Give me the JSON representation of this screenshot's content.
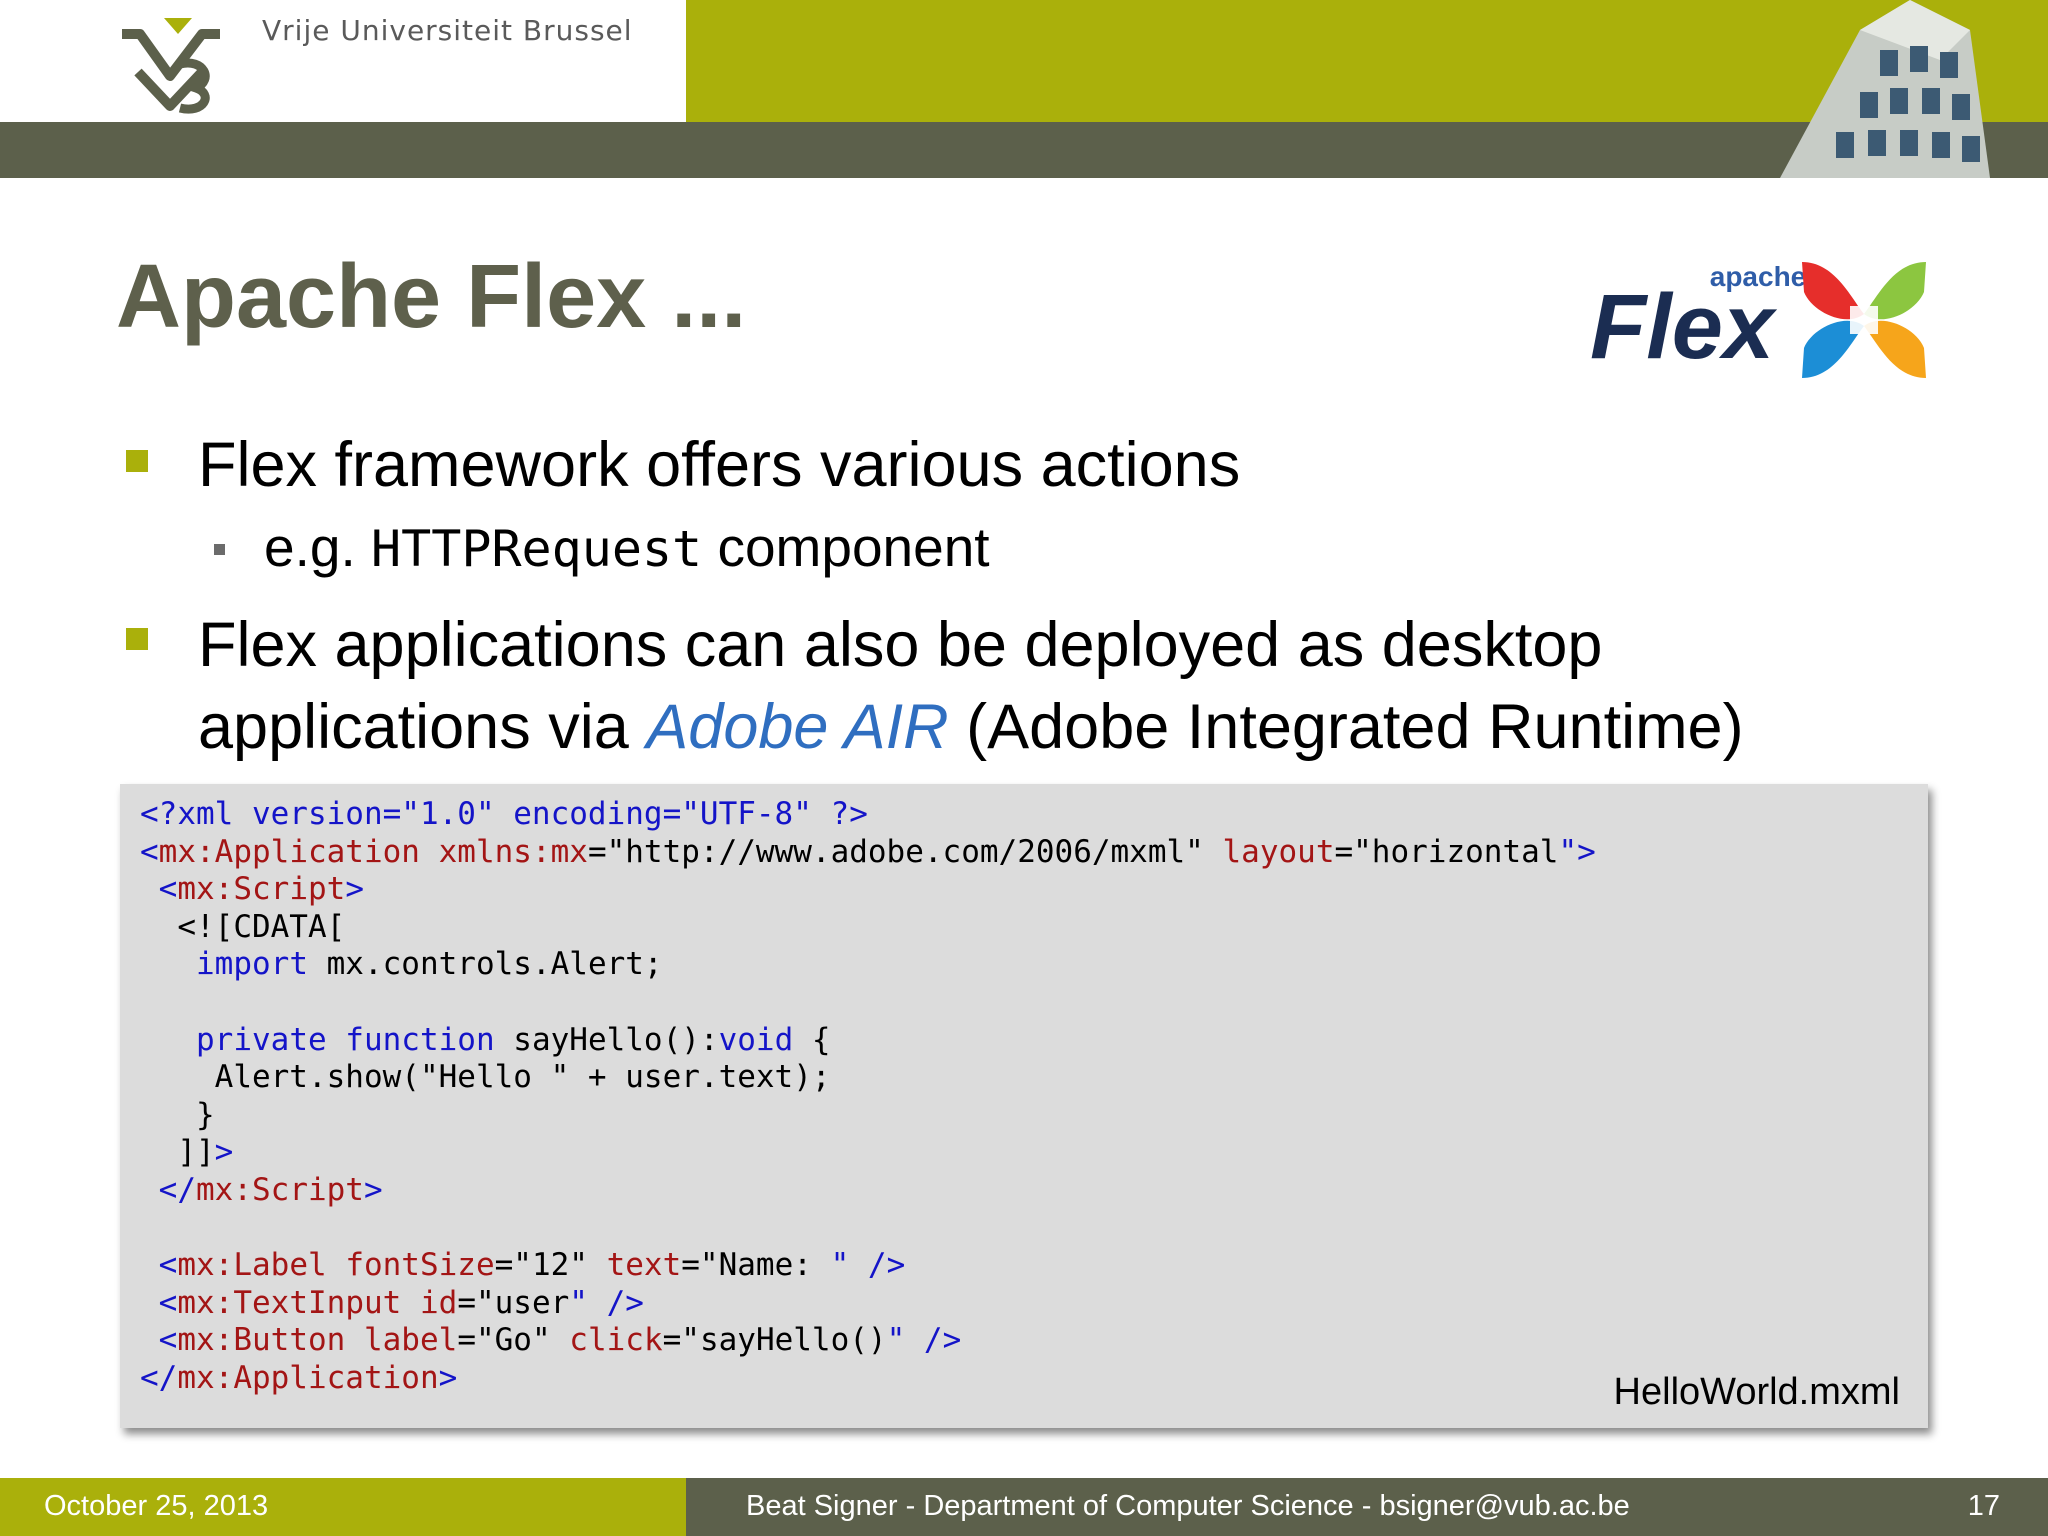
{
  "header": {
    "university": "Vrije Universiteit Brussel",
    "colors": {
      "olive": "#aab00b",
      "dark": "#5c604b"
    }
  },
  "slide": {
    "title": "Apache Flex ...",
    "logo": {
      "small_text": "apache",
      "big_text": "Flex"
    },
    "bullets": [
      {
        "text": "Flex framework offers various actions",
        "sub": {
          "prefix": "e.g. ",
          "code": "HTTPRequest",
          "suffix": " component"
        }
      },
      {
        "line1": "Flex applications can also be deployed as desktop",
        "line2_prefix": "applications via ",
        "line2_link": "Adobe AIR",
        "line2_suffix": " (Adobe Integrated Runtime)"
      }
    ],
    "code": {
      "filename": "HelloWorld.mxml",
      "lines": [
        [
          [
            "b",
            "<?xml version=\"1.0\" encoding=\"UTF-8\" ?>"
          ]
        ],
        [
          [
            "b",
            "<"
          ],
          [
            "r",
            "mx:Application xmlns:mx"
          ],
          [
            "k",
            "=\"http://www.adobe.com/2006/mxml\" "
          ],
          [
            "r",
            "layout"
          ],
          [
            "k",
            "=\"horizontal"
          ],
          [
            "b",
            "\">"
          ]
        ],
        [
          [
            "k",
            " "
          ],
          [
            "b",
            "<"
          ],
          [
            "r",
            "mx:Script"
          ],
          [
            "b",
            ">"
          ]
        ],
        [
          [
            "k",
            "  <![CDATA["
          ]
        ],
        [
          [
            "k",
            "   "
          ],
          [
            "b",
            "import"
          ],
          [
            "k",
            " mx.controls.Alert;"
          ]
        ],
        [
          [
            "k",
            ""
          ]
        ],
        [
          [
            "k",
            "   "
          ],
          [
            "b",
            "private function"
          ],
          [
            "k",
            " sayHello():"
          ],
          [
            "b",
            "void"
          ],
          [
            "k",
            " {"
          ]
        ],
        [
          [
            "k",
            "    Alert.show(\"Hello \" + user.text);"
          ]
        ],
        [
          [
            "k",
            "   }"
          ]
        ],
        [
          [
            "k",
            "  ]]"
          ],
          [
            "b",
            ">"
          ]
        ],
        [
          [
            "k",
            " "
          ],
          [
            "b",
            "</"
          ],
          [
            "r",
            "mx:Script"
          ],
          [
            "b",
            ">"
          ]
        ],
        [
          [
            "k",
            ""
          ]
        ],
        [
          [
            "k",
            " "
          ],
          [
            "b",
            "<"
          ],
          [
            "r",
            "mx:Label fontSize"
          ],
          [
            "k",
            "=\"12\" "
          ],
          [
            "r",
            "text"
          ],
          [
            "k",
            "=\"Name: "
          ],
          [
            "b",
            "\" />"
          ]
        ],
        [
          [
            "k",
            " "
          ],
          [
            "b",
            "<"
          ],
          [
            "r",
            "mx:TextInput id"
          ],
          [
            "k",
            "=\"user"
          ],
          [
            "b",
            "\" />"
          ]
        ],
        [
          [
            "k",
            " "
          ],
          [
            "b",
            "<"
          ],
          [
            "r",
            "mx:Button label"
          ],
          [
            "k",
            "=\"Go\" "
          ],
          [
            "r",
            "click"
          ],
          [
            "k",
            "=\"sayHello()"
          ],
          [
            "b",
            "\" />"
          ]
        ],
        [
          [
            "b",
            "</"
          ],
          [
            "r",
            "mx:Application"
          ],
          [
            "b",
            ">"
          ]
        ]
      ]
    }
  },
  "footer": {
    "date": "October 25, 2013",
    "author": "Beat Signer - Department of Computer Science - bsigner@vub.ac.be",
    "page": "17"
  }
}
